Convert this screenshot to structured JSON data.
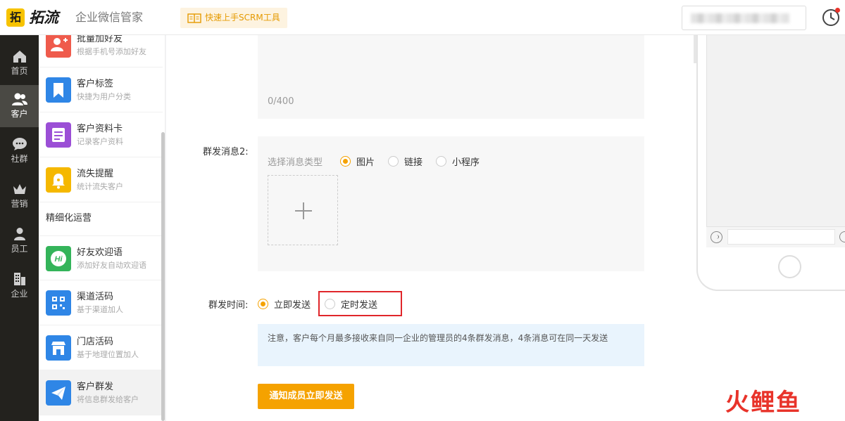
{
  "header": {
    "logo_mark": "拓",
    "logo_text": "拓流",
    "subtitle": "企业微信管家",
    "guide_button": "快速上手SCRM工具",
    "accent": "#f7c300"
  },
  "rail": {
    "items": [
      {
        "label": "首页",
        "icon": "home-icon"
      },
      {
        "label": "客户",
        "icon": "users-icon",
        "active": true
      },
      {
        "label": "社群",
        "icon": "chat-icon"
      },
      {
        "label": "营销",
        "icon": "crown-icon"
      },
      {
        "label": "员工",
        "icon": "person-icon"
      },
      {
        "label": "企业",
        "icon": "building-icon"
      }
    ]
  },
  "submenu": {
    "items": [
      {
        "title": "批量加好友",
        "desc": "根据手机号添加好友",
        "icon": "add-user-icon",
        "color": "#ef5b4c"
      },
      {
        "title": "客户标签",
        "desc": "快捷为用户分类",
        "icon": "bookmark-icon",
        "color": "#2f86e6"
      },
      {
        "title": "客户资料卡",
        "desc": "记录客户资料",
        "icon": "card-icon",
        "color": "#9b4fd6"
      },
      {
        "title": "流失提醒",
        "desc": "统计流失客户",
        "icon": "bell-icon",
        "color": "#f5b800"
      },
      {
        "title": "好友欢迎语",
        "desc": "添加好友自动欢迎语",
        "icon": "hi-icon",
        "color": "#34b45a"
      },
      {
        "title": "渠道活码",
        "desc": "基于渠道加人",
        "icon": "qrcode-icon",
        "color": "#2f86e6"
      },
      {
        "title": "门店活码",
        "desc": "基于地理位置加人",
        "icon": "store-icon",
        "color": "#2f86e6"
      },
      {
        "title": "客户群发",
        "desc": "将信息群发给客户",
        "icon": "send-icon",
        "color": "#2f86e6",
        "active": true
      }
    ],
    "section": "精细化运营"
  },
  "form": {
    "counter": "0/400",
    "message2_label": "群发消息2:",
    "type_placeholder": "选择消息类型",
    "types": [
      "图片",
      "链接",
      "小程序"
    ],
    "time_label": "群发时间:",
    "time_options": [
      "立即发送",
      "定时发送"
    ],
    "notice": "注意，客户每个月最多接收来自同一企业的管理员的4条群发消息，4条消息可在同一天发送",
    "send_button": "通知成员立即发送"
  },
  "watermark": {
    "chars": [
      "火",
      "鲤",
      "鱼"
    ],
    "colors": [
      "#e8332a",
      "#e8332a",
      "#e8332a"
    ]
  }
}
